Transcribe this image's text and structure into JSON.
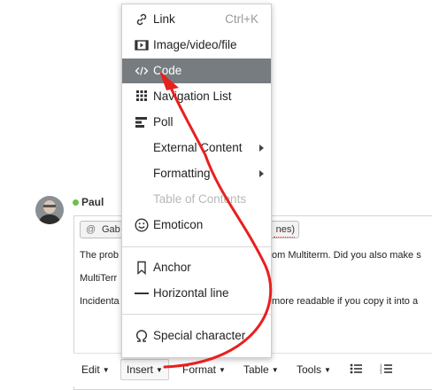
{
  "comment": {
    "username": "Paul",
    "mention_at": "@",
    "mention_visible": "Gab",
    "mention_tail": "nes)",
    "lines": [
      {
        "left": "The prob",
        "right": "om Multiterm.  Did you also make s"
      },
      {
        "left": "MultiTerr",
        "right": ""
      },
      {
        "left": "Incidenta",
        "right": "more readable if you copy it into a"
      }
    ]
  },
  "toolbar": {
    "edit": "Edit",
    "insert": "Insert",
    "format": "Format",
    "table": "Table",
    "tools": "Tools"
  },
  "insert_menu": {
    "link": {
      "label": "Link",
      "shortcut": "Ctrl+K"
    },
    "media": {
      "label": "Image/video/file"
    },
    "code": {
      "label": "Code"
    },
    "nav_list": {
      "label": "Navigation List"
    },
    "poll": {
      "label": "Poll"
    },
    "external": {
      "label": "External Content"
    },
    "formatting": {
      "label": "Formatting"
    },
    "toc": {
      "label": "Table of Contents"
    },
    "emoticon": {
      "label": "Emoticon"
    },
    "anchor": {
      "label": "Anchor"
    },
    "hline": {
      "label": "Horizontal line"
    },
    "special": {
      "label": "Special character"
    }
  },
  "annotation_color": "#e8201f",
  "highlight_color": "#777c80"
}
